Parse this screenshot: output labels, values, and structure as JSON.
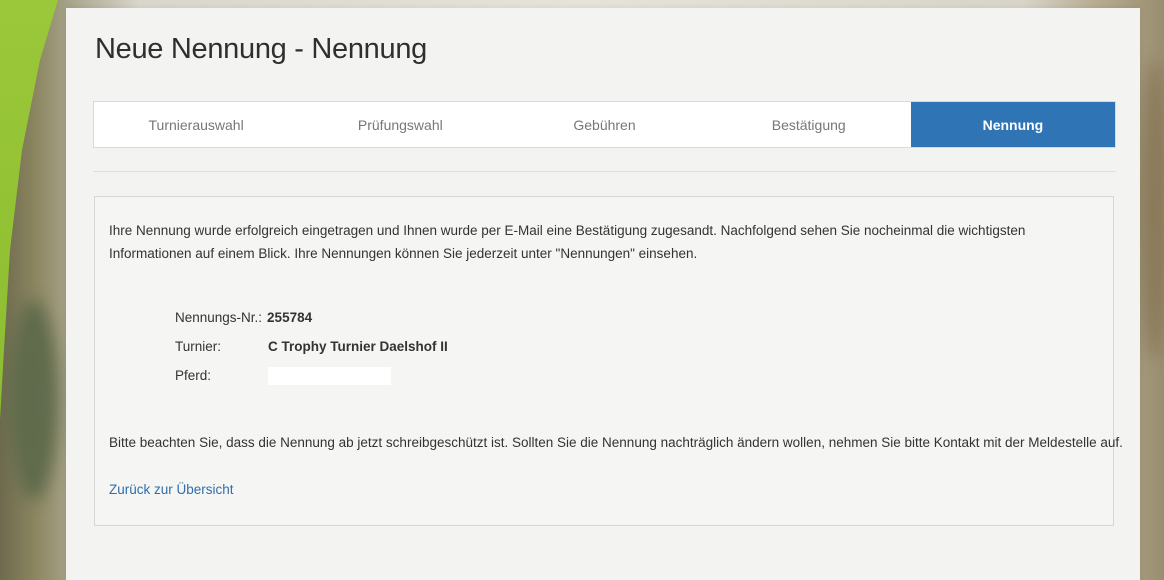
{
  "page": {
    "title": "Neue Nennung - Nennung"
  },
  "steps": [
    {
      "label": "Turnierauswahl",
      "active": false
    },
    {
      "label": "Prüfungswahl",
      "active": false
    },
    {
      "label": "Gebühren",
      "active": false
    },
    {
      "label": "Bestätigung",
      "active": false
    },
    {
      "label": "Nennung",
      "active": true
    }
  ],
  "confirmation": {
    "intro": "Ihre Nennung wurde erfolgreich eingetragen und Ihnen wurde per E-Mail eine Bestätigung zugesandt. Nachfolgend sehen Sie nocheinmal die wichtigsten Informationen auf einem Blick. Ihre Nennungen können Sie jederzeit unter \"Nennungen\" einsehen.",
    "nennungs_nr_label": "Nennungs-Nr.:",
    "nennungs_nr_value": "255784",
    "turnier_label": "Turnier:",
    "turnier_value": "C Trophy Turnier Daelshof II",
    "pferd_label": "Pferd:",
    "note": "Bitte beachten Sie, dass die Nennung ab jetzt schreibgeschützt ist. Sollten Sie die Nennung nachträglich ändern wollen, nehmen Sie bitte Kontakt mit der Meldestelle auf.",
    "back_link": "Zurück zur Übersicht"
  },
  "colors": {
    "accent": "#2f74b5",
    "link": "#2f6ea8",
    "brand_green": "#8cbd30"
  }
}
